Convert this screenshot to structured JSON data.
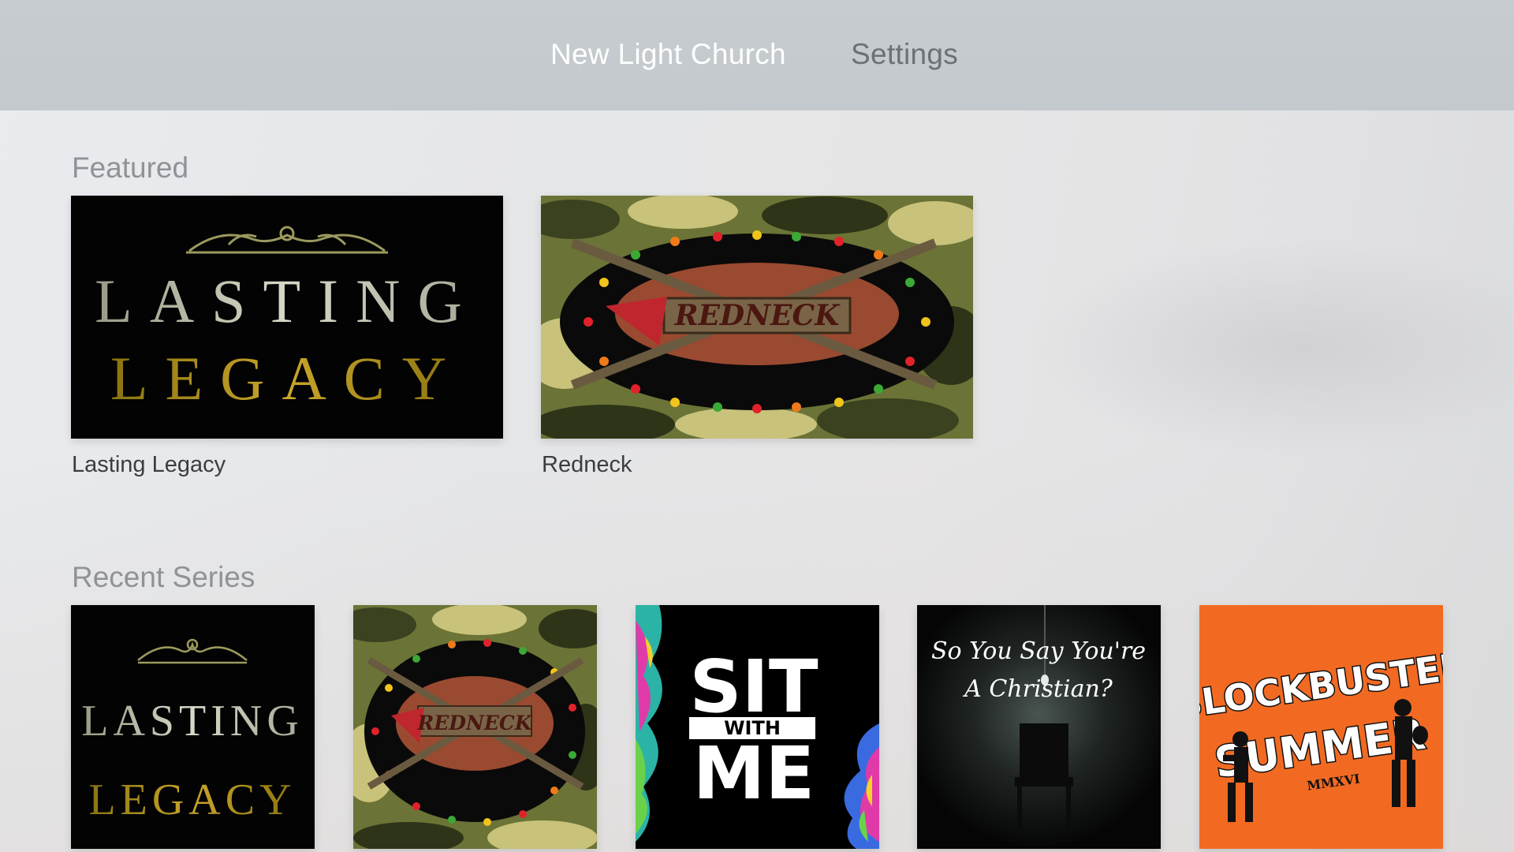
{
  "nav": {
    "tabs": [
      {
        "label": "New Light Church",
        "active": true
      },
      {
        "label": "Settings",
        "active": false
      }
    ]
  },
  "featured": {
    "title": "Featured",
    "items": [
      {
        "label": "Lasting Legacy",
        "art_line1": "LASTING",
        "art_line2": "LEGACY"
      },
      {
        "label": "Redneck",
        "art_text": "REDNECK"
      }
    ]
  },
  "recent": {
    "title": "Recent Series",
    "items": [
      {
        "art_line1": "LASTING",
        "art_line2": "LEGACY"
      },
      {
        "art_text": "REDNECK"
      },
      {
        "art_line1": "SIT",
        "art_line2": "WITH",
        "art_line3": "ME"
      },
      {
        "art_line1": "So You Say You're",
        "art_line2": "A Christian?"
      },
      {
        "art_line1": "BLOCKBUSTER",
        "art_line2": "SUMMER",
        "art_line3": "MMXVI"
      }
    ]
  },
  "colors": {
    "nav_bg": "#c4cacd",
    "active_tab": "#ffffff",
    "inactive_tab": "#6b7176",
    "section_title": "#8f9397",
    "card_label": "#3b3d40",
    "blockbuster_orange": "#f26a22"
  }
}
